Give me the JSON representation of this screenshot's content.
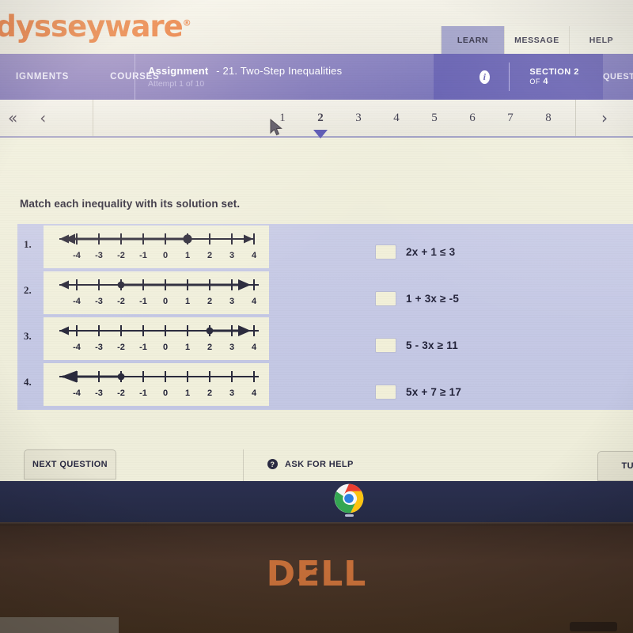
{
  "brand": {
    "logo_text": "odysseyware",
    "trademark": "®"
  },
  "top_tabs": [
    {
      "label": "LEARN",
      "active": true
    },
    {
      "label": "MESSAGE",
      "active": false
    },
    {
      "label": "HELP",
      "active": false
    }
  ],
  "nav": {
    "links": [
      {
        "label": "IGNMENTS"
      },
      {
        "label": "COURSES"
      }
    ],
    "assignment_prefix": "Assignment",
    "assignment_title": "- 21. Two-Step Inequalities",
    "attempt": "Attempt 1 of 10",
    "info_icon": "info-icon",
    "section_label": "SECTION 2",
    "section_of": "OF",
    "section_total": "4",
    "question_label": "QUEST"
  },
  "pager": {
    "first_icon": "«",
    "prev_icon": "‹",
    "next_icon": "›",
    "pages": [
      "1",
      "2",
      "3",
      "4",
      "5",
      "6",
      "7",
      "8"
    ],
    "active_page": "2"
  },
  "question": {
    "prompt": "Match each inequality with its solution set.",
    "number_lines": [
      {
        "index": "1.",
        "ticks": [
          "-4",
          "-3",
          "-2",
          "-1",
          "0",
          "1",
          "2",
          "3",
          "4"
        ],
        "point": 1,
        "direction": "left",
        "closed": true
      },
      {
        "index": "2.",
        "ticks": [
          "-4",
          "-3",
          "-2",
          "-1",
          "0",
          "1",
          "2",
          "3",
          "4"
        ],
        "point": -2,
        "direction": "right",
        "closed": true
      },
      {
        "index": "3.",
        "ticks": [
          "-4",
          "-3",
          "-2",
          "-1",
          "0",
          "1",
          "2",
          "3",
          "4"
        ],
        "point": 2,
        "direction": "right",
        "closed": true
      },
      {
        "index": "4.",
        "ticks": [
          "-4",
          "-3",
          "-2",
          "-1",
          "0",
          "1",
          "2",
          "3",
          "4"
        ],
        "point": -2,
        "direction": "left",
        "closed": true
      }
    ],
    "answers": [
      {
        "expression": "2x + 1 ≤ 3",
        "value": ""
      },
      {
        "expression": "1 + 3x ≥ -5",
        "value": ""
      },
      {
        "expression": "5 - 3x ≥ 11",
        "value": ""
      },
      {
        "expression": "5x + 7 ≥ 17",
        "value": ""
      }
    ]
  },
  "footer": {
    "next_question": "NEXT QUESTION",
    "ask_for_help": "ASK FOR HELP",
    "ask_icon": "question-mark-icon",
    "turn_in": "TURN I"
  },
  "device": {
    "brand": "DELL",
    "taskbar_icon": "chrome-icon"
  },
  "colors": {
    "brand_orange": "#e2622c",
    "nav_purple": "#6f6ab4",
    "section_purple": "#5c57ae",
    "panel_blue": "#c6c9e5",
    "screen_cream": "#efeedb",
    "dell_orange": "#c8703a"
  }
}
